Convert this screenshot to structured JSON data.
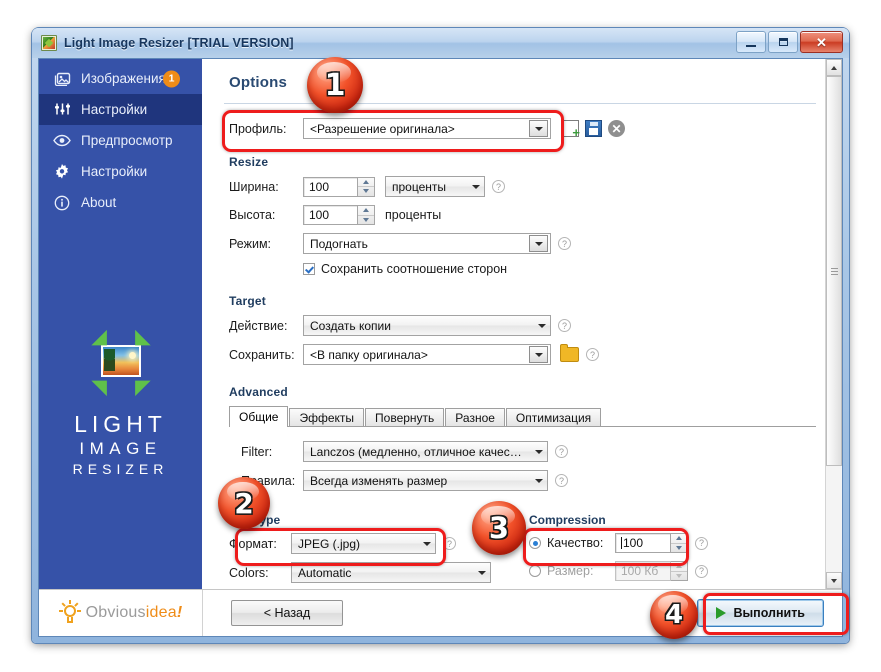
{
  "window": {
    "title": "Light Image Resizer  [TRIAL VERSION]",
    "minimize_label": "",
    "maximize_label": "",
    "close_label": "✕"
  },
  "sidebar": {
    "items": [
      {
        "label": "Изображения",
        "icon": "images-icon",
        "badge": "1",
        "active": false
      },
      {
        "label": "Настройки",
        "icon": "sliders-icon",
        "badge": "",
        "active": true
      },
      {
        "label": "Предпросмотр",
        "icon": "eye-icon",
        "badge": "",
        "active": false
      },
      {
        "label": "Настройки",
        "icon": "gear-icon",
        "badge": "",
        "active": false
      },
      {
        "label": "About",
        "icon": "info-icon",
        "badge": "",
        "active": false
      }
    ],
    "logo": {
      "line1": "LIGHT",
      "line2": "IMAGE",
      "line3": "RESIZER"
    }
  },
  "options": {
    "header": "Options",
    "profile": {
      "label": "Профиль:",
      "value": "<Разрешение оригинала>",
      "new_icon": "new-profile-icon",
      "save_icon": "save-profile-icon",
      "delete_icon": "delete-profile-icon"
    },
    "resize": {
      "title": "Resize",
      "width_label": "Ширина:",
      "width_value": "100",
      "width_unit": "проценты",
      "height_label": "Высота:",
      "height_value": "100",
      "height_unit": "проценты",
      "mode_label": "Режим:",
      "mode_value": "Подогнать",
      "keep_aspect_label": "Сохранить соотношение сторон",
      "keep_aspect_checked": true
    },
    "target": {
      "title": "Target",
      "action_label": "Действие:",
      "action_value": "Создать копии",
      "save_label": "Сохранить:",
      "save_value": "<В папку оригинала>",
      "folder_icon": "folder-icon"
    },
    "advanced": {
      "title": "Advanced",
      "tabs": [
        {
          "label": "Общие",
          "active": true
        },
        {
          "label": "Эффекты",
          "active": false
        },
        {
          "label": "Повернуть",
          "active": false
        },
        {
          "label": "Разное",
          "active": false
        },
        {
          "label": "Оптимизация",
          "active": false
        }
      ],
      "filter_label": "Filter:",
      "filter_value": "Lanczos  (медленно, отличное качество)",
      "rules_label": "Правила:",
      "rules_value": "Всегда изменять размер"
    },
    "file_type": {
      "title": "File Type",
      "format_label": "Формат:",
      "format_value": "JPEG (.jpg)",
      "colors_label": "Colors:",
      "colors_value": "Automatic"
    },
    "compression": {
      "title": "Compression",
      "quality_label": "Качество:",
      "quality_value": "100",
      "quality_selected": true,
      "size_label": "Размер:",
      "size_value": "100 Кб",
      "size_selected": false
    }
  },
  "footer": {
    "brand": {
      "part1": "Obvious",
      "part2": "idea",
      "part3": "!"
    },
    "back_label": "< Назад",
    "run_label": "Выполнить",
    "run_icon": "play-icon"
  },
  "callouts": [
    {
      "number": "1"
    },
    {
      "number": "2"
    },
    {
      "number": "3"
    },
    {
      "number": "4"
    }
  ],
  "colors": {
    "sidebar": "#3652A8",
    "sidebar_active": "#1F357D",
    "badge": "#EF8C18",
    "highlight": "#EE1C1C",
    "accent_text": "#1F3C5F"
  }
}
